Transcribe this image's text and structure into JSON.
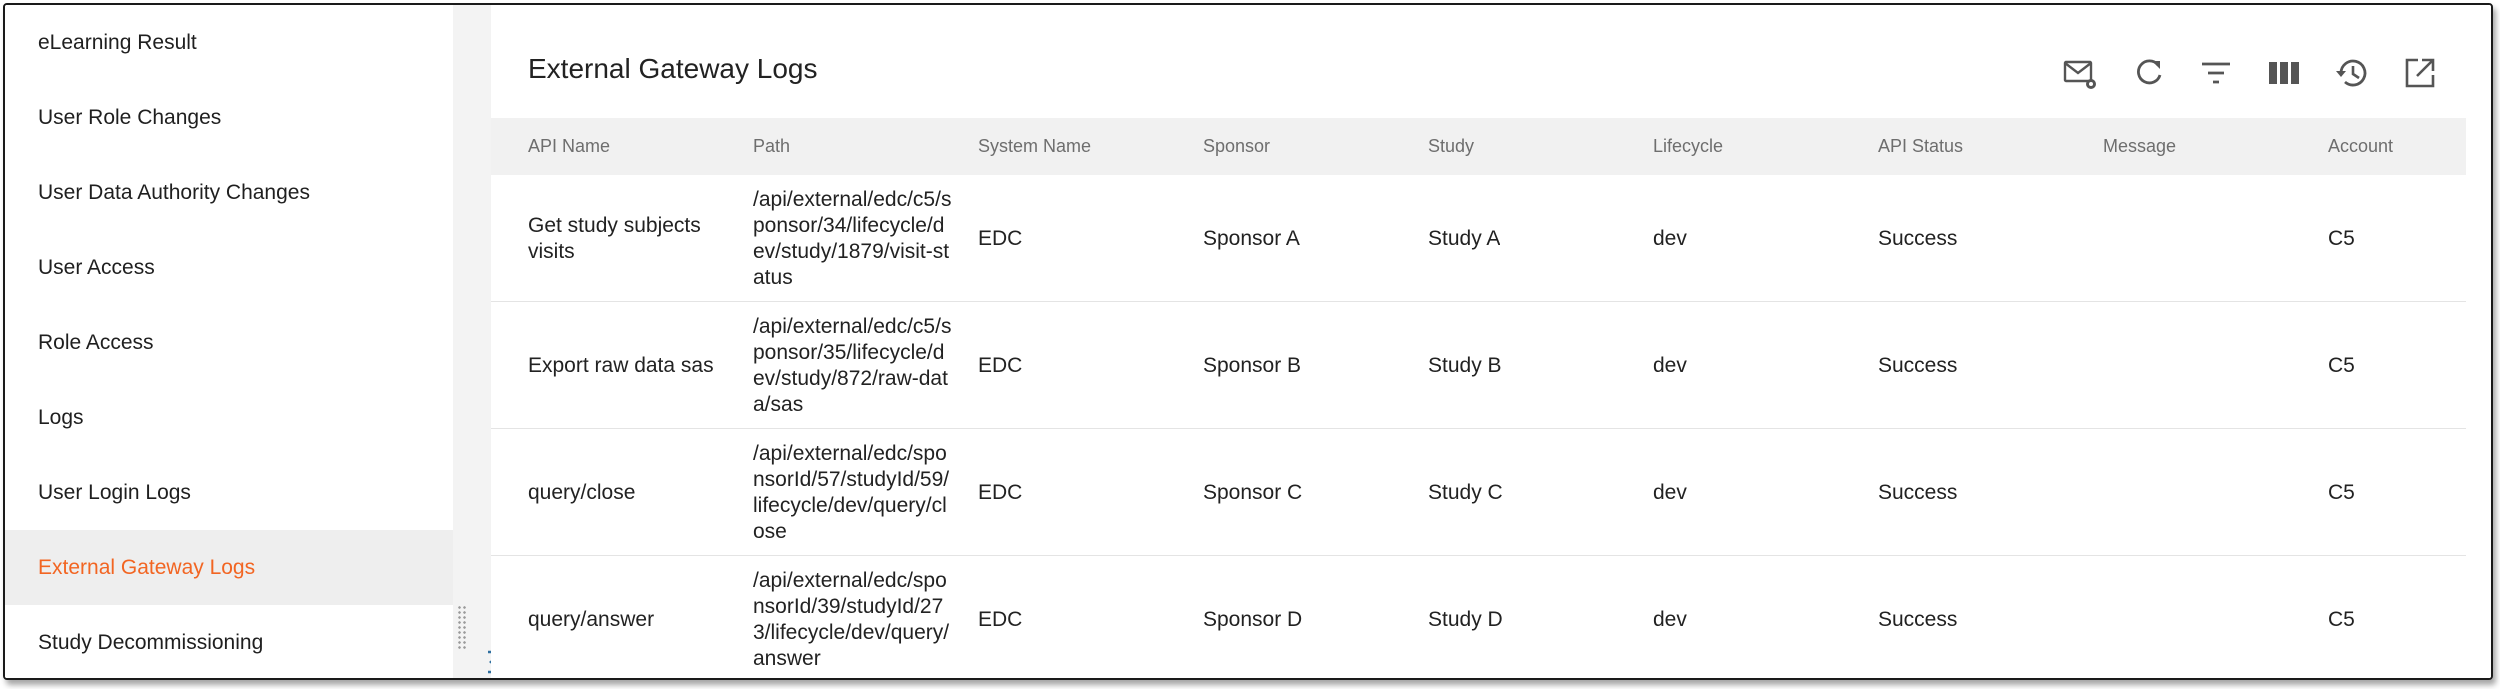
{
  "sidebar": {
    "items": [
      {
        "label": "eLearning Result",
        "active": false
      },
      {
        "label": "User Role Changes",
        "active": false
      },
      {
        "label": "User Data Authority Changes",
        "active": false
      },
      {
        "label": "User Access",
        "active": false
      },
      {
        "label": "Role Access",
        "active": false
      },
      {
        "label": "Logs",
        "active": false
      },
      {
        "label": "User Login Logs",
        "active": false
      },
      {
        "label": "External Gateway Logs",
        "active": true
      },
      {
        "label": "Study Decommissioning",
        "active": false
      }
    ]
  },
  "main": {
    "title": "External Gateway Logs",
    "toolbar": [
      "mail-settings-icon",
      "refresh-icon",
      "filter-icon",
      "columns-icon",
      "history-icon",
      "open-external-icon"
    ]
  },
  "table": {
    "columns": [
      "API Name",
      "Path",
      "System Name",
      "Sponsor",
      "Study",
      "Lifecycle",
      "API Status",
      "Message",
      "Account"
    ],
    "rows": [
      {
        "api_name": "Get study subjects visits",
        "path": "/api/external/edc/c5/sponsor/34/lifecycle/dev/study/1879/visit-status",
        "system": "EDC",
        "sponsor": "Sponsor A",
        "study": "Study A",
        "lifecycle": "dev",
        "status": "Success",
        "message": "",
        "account": "C5"
      },
      {
        "api_name": "Export raw data sas",
        "path": "/api/external/edc/c5/sponsor/35/lifecycle/dev/study/872/raw-data/sas",
        "system": "EDC",
        "sponsor": "Sponsor B",
        "study": "Study B",
        "lifecycle": "dev",
        "status": "Success",
        "message": "",
        "account": "C5"
      },
      {
        "api_name": "query/close",
        "path": "/api/external/edc/sponsorId/57/studyId/59/lifecycle/dev/query/close",
        "system": "EDC",
        "sponsor": "Sponsor C",
        "study": "Study C",
        "lifecycle": "dev",
        "status": "Success",
        "message": "",
        "account": "C5"
      },
      {
        "api_name": "query/answer",
        "path": "/api/external/edc/sponsorId/39/studyId/273/lifecycle/dev/query/answer",
        "system": "EDC",
        "sponsor": "Sponsor D",
        "study": "Study D",
        "lifecycle": "dev",
        "status": "Success",
        "message": "",
        "account": "C5"
      }
    ]
  },
  "colors": {
    "accent": "#f26522",
    "active_bg": "#eeeeee",
    "header_bg": "#f1f1f1"
  }
}
